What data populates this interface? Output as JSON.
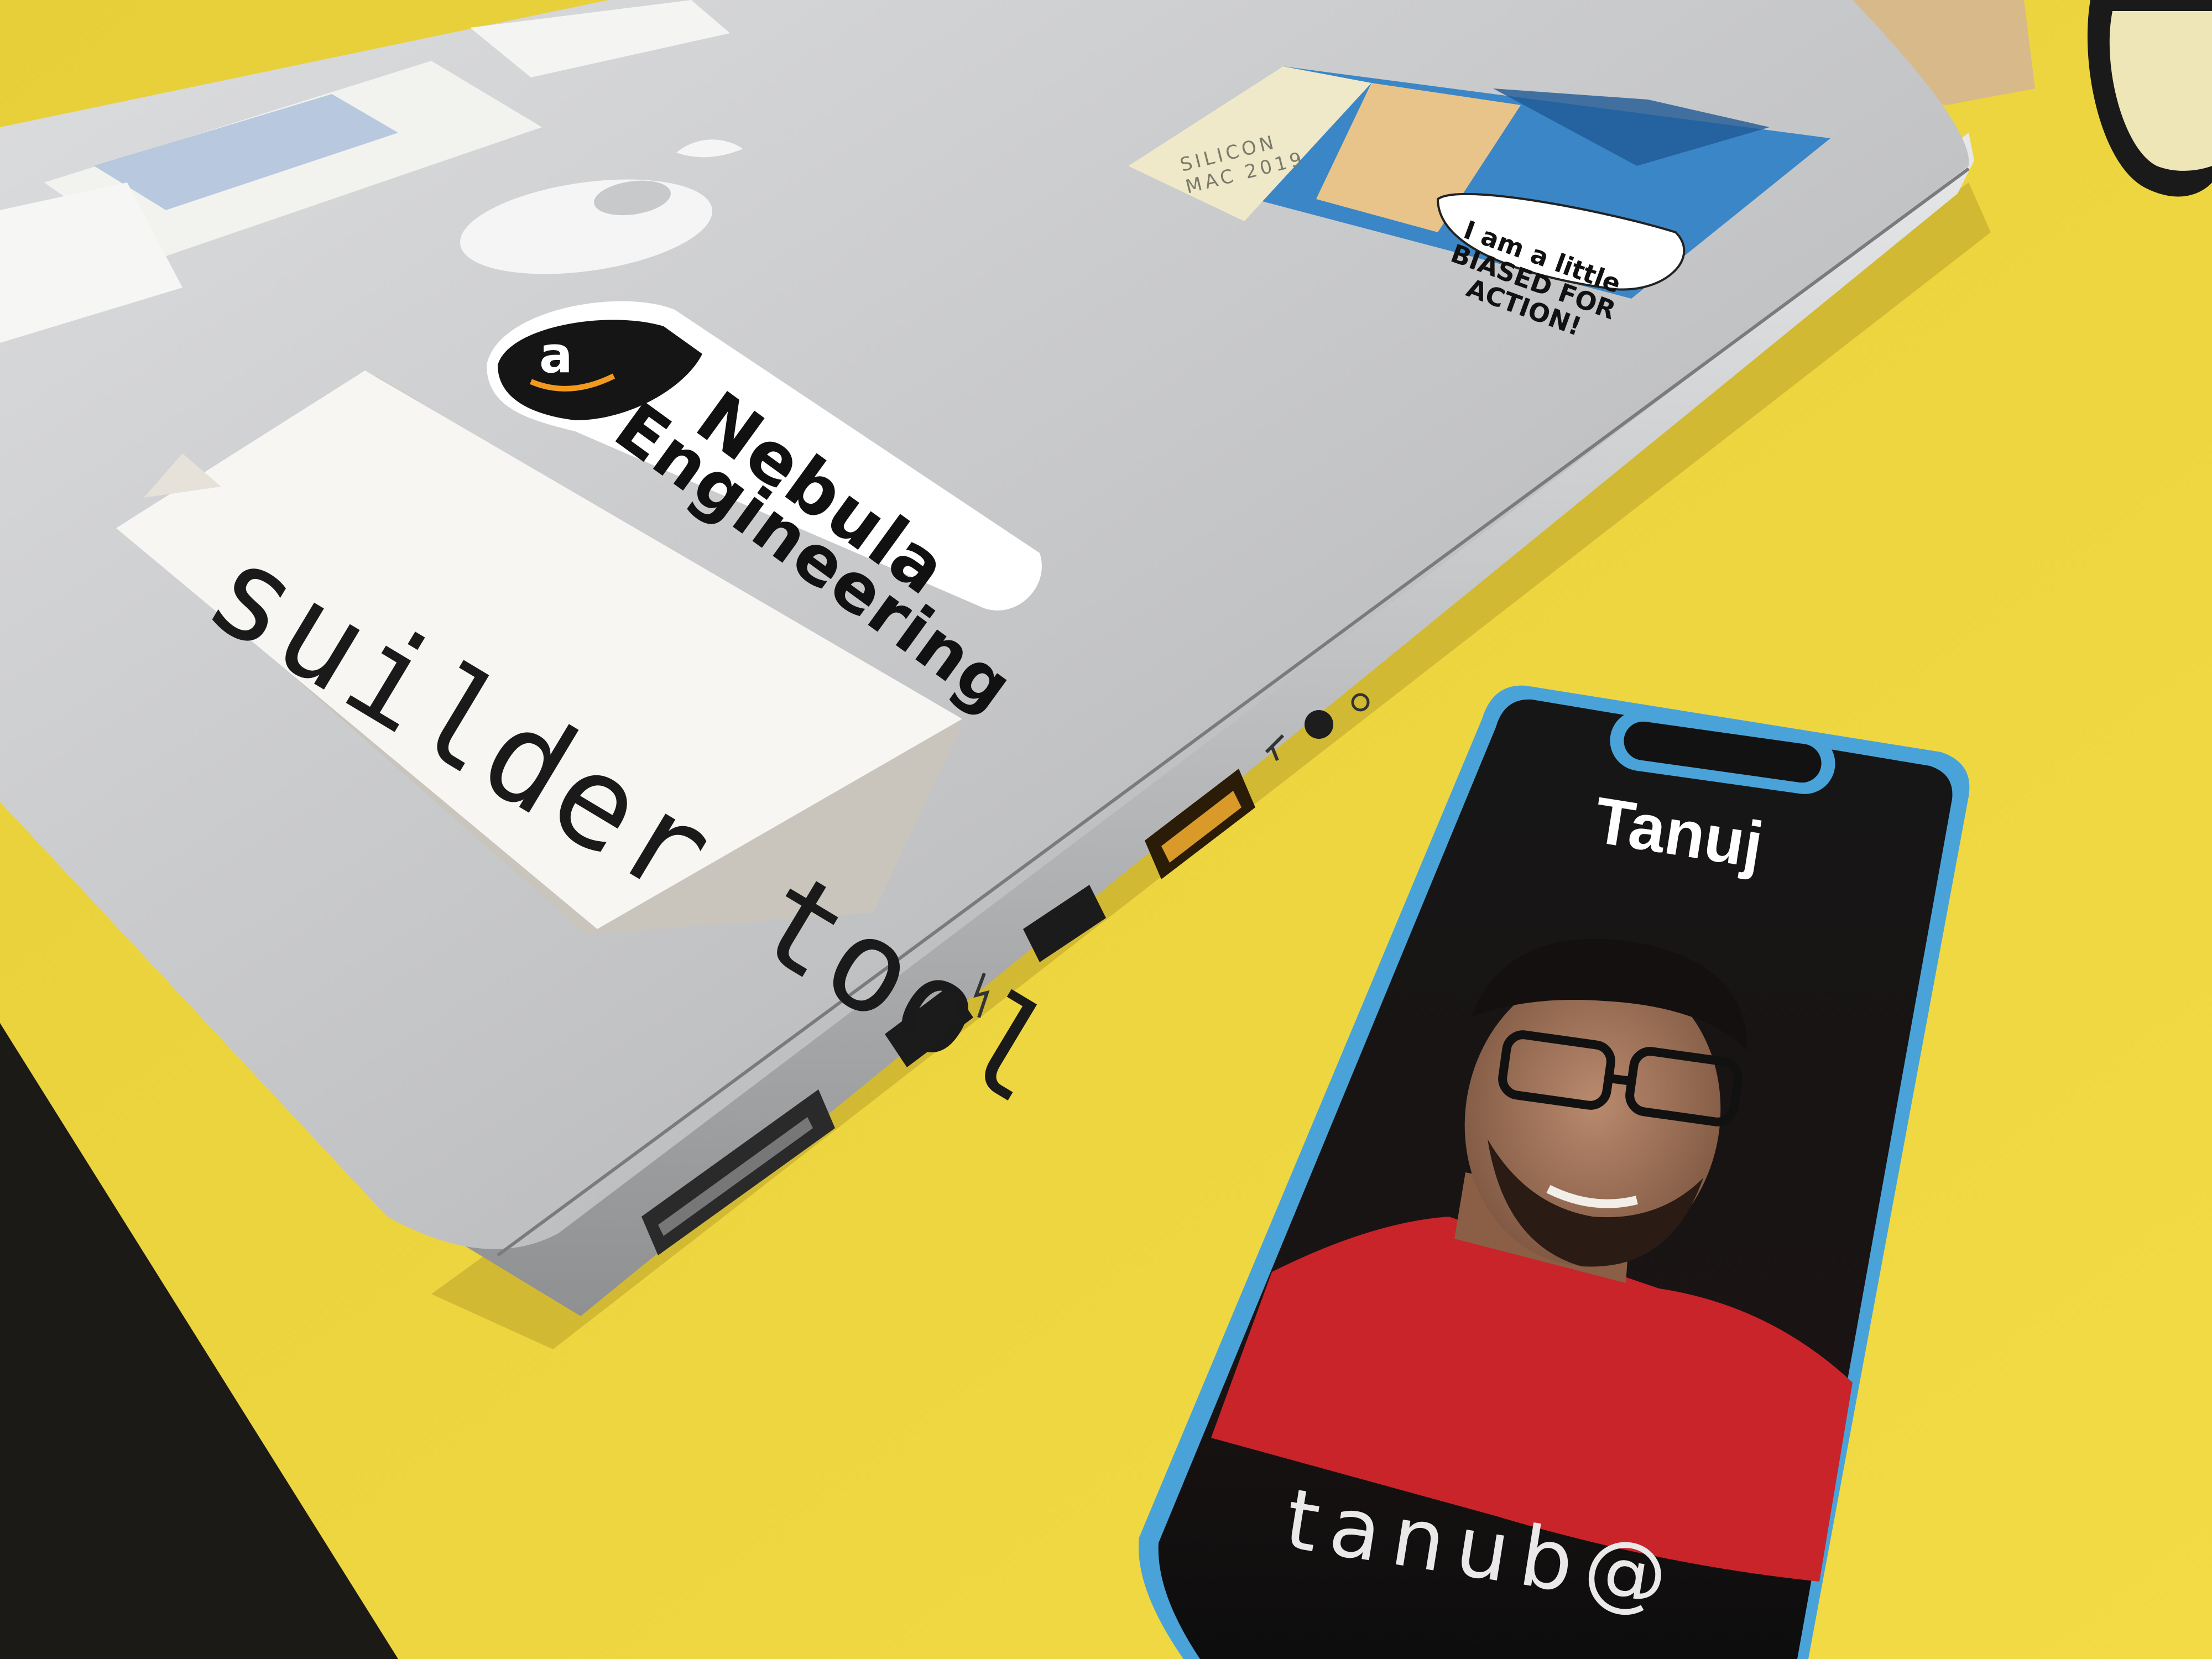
{
  "scene": {
    "colors": {
      "table": "#f0d63d",
      "laptop": "#c4c5c7",
      "badge_border": "#4aa3d8",
      "shirt": "#c8242a"
    }
  },
  "sticker_aws": {
    "logo_letter": "a",
    "line1": "Nebula",
    "line2": "Engineering"
  },
  "sticker_builder": {
    "text": "suilder tool"
  },
  "sticker_comic": {
    "speech": "I am a little BIASED FOR ACTION!",
    "event_text": "SILICON MAC 2019"
  },
  "badge": {
    "name": "Tanuj",
    "alias": "tanub@"
  },
  "icons": [
    "apple-logo-icon",
    "usb-icon",
    "thunderbolt-icon",
    "headphone-icon",
    "glasses-icon"
  ]
}
